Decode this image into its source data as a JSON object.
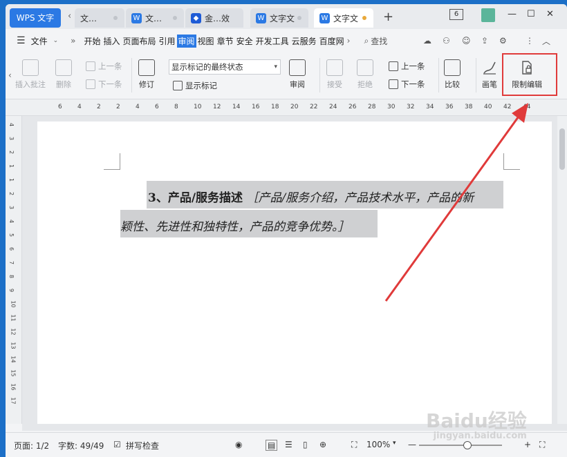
{
  "app_tab": "WPS 文字",
  "doc_tabs": [
    "文…",
    "文…",
    "金…效",
    "文字文",
    "文字文"
  ],
  "window_count": "6",
  "menu": {
    "file": "文件",
    "items": [
      "开始",
      "插入",
      "页面布局",
      "引用",
      "审阅",
      "视图",
      "章节",
      "安全",
      "开发工具",
      "云服务",
      "百度网"
    ],
    "active": "审阅",
    "search": "查找"
  },
  "toolbar": {
    "insert_comment": "插入批注",
    "delete": "删除",
    "prev_comment": "上一条",
    "next_comment": "下一条",
    "revise": "修订",
    "markup_select": "显示标记的最终状态",
    "show_markup": "显示标记",
    "review": "审阅",
    "accept": "接受",
    "reject": "拒绝",
    "prev_change": "上一条",
    "next_change": "下一条",
    "compare": "比较",
    "ink": "画笔",
    "restrict_editing": "限制编辑"
  },
  "ruler_numbers": [
    "6",
    "4",
    "2",
    "2",
    "4",
    "6",
    "8",
    "10",
    "12",
    "14",
    "16",
    "18",
    "20",
    "22",
    "24",
    "26",
    "28",
    "30",
    "32",
    "34",
    "36",
    "38",
    "40",
    "42",
    "44"
  ],
  "vruler_numbers": [
    "4",
    "3",
    "2",
    "1",
    "1",
    "2",
    "3",
    "4",
    "5",
    "6",
    "7",
    "8",
    "9",
    "10",
    "11",
    "12",
    "13",
    "14",
    "15",
    "16",
    "17"
  ],
  "document": {
    "heading": "3、产品/服务描述",
    "line1_tail": "［产品/服务介绍，产品技术水平，产品的新",
    "line2": "颖性、先进性和独特性，产品的竞争优势。］"
  },
  "status": {
    "page": "页面: 1/2",
    "words": "字数: 49/49",
    "spellcheck": "拼写检查",
    "zoom": "100%"
  },
  "watermark": "Baidu经验",
  "watermark_url": "jingyan.baidu.com",
  "colors": {
    "accent": "#2b79e4",
    "highlight_box": "#e03a3a",
    "selection": "#cfd0d2"
  }
}
